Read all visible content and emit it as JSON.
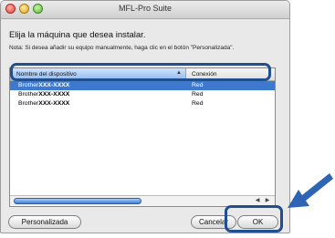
{
  "window": {
    "title": "MFL-Pro Suite"
  },
  "dialog": {
    "heading": "Elija la máquina que desea instalar.",
    "note": "Nota: Si desea añadir su equipo manualmente, haga clic en el botón \"Personalizada\"."
  },
  "table": {
    "columns": [
      "Nombre del dispositivo",
      "Conexión"
    ],
    "rows": [
      {
        "brand": "Brother",
        "model": "XXX-XXXX",
        "connection": "Red",
        "selected": true
      },
      {
        "brand": "Brother",
        "model": "XXX-XXXX",
        "connection": "Red",
        "selected": false
      },
      {
        "brand": "Brother",
        "model": "XXX-XXXX",
        "connection": "Red",
        "selected": false
      }
    ]
  },
  "buttons": {
    "custom": "Personalizada",
    "cancel": "Cancelar",
    "ok": "OK"
  },
  "colors": {
    "highlight": "#1f4f8e",
    "selection": "#3e79d0",
    "pointer": "#2f63b4"
  }
}
